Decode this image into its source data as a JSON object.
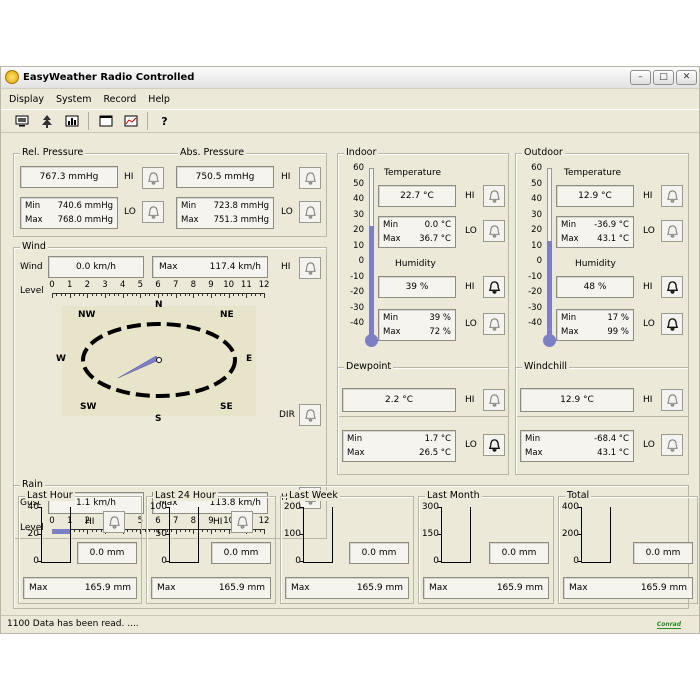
{
  "window": {
    "title": "EasyWeather Radio Controlled",
    "controls": [
      "–",
      "□",
      "✕"
    ]
  },
  "menu": [
    "Display",
    "System",
    "Record",
    "Help"
  ],
  "toolbar": [
    "monitor-icon",
    "tree-icon",
    "chart-bars-icon",
    "window-icon",
    "line-chart-icon",
    "help-icon"
  ],
  "pressure": {
    "rel": {
      "label": "Rel. Pressure",
      "value": "767.3 mmHg",
      "min": "740.6 mmHg",
      "max": "768.0 mmHg"
    },
    "abs": {
      "label": "Abs. Pressure",
      "value": "750.5 mmHg",
      "min": "723.8 mmHg",
      "max": "751.3 mmHg"
    }
  },
  "labels": {
    "hi": "HI",
    "lo": "LO",
    "min": "Min",
    "max": "Max",
    "dir": "DIR",
    "level": "Level"
  },
  "wind": {
    "label": "Wind",
    "wind_label": "Wind",
    "wind_value": "0.0 km/h",
    "wind_max": "117.4 km/h",
    "gust_label": "Gust",
    "gust_value": "1.1 km/h",
    "gust_max": "113.8 km/h",
    "level_ticks": [
      "0",
      "1",
      "2",
      "3",
      "4",
      "5",
      "6",
      "7",
      "8",
      "9",
      "10",
      "11",
      "12"
    ],
    "wind_level": 0,
    "gust_level": 1,
    "compass": {
      "N": "N",
      "NE": "NE",
      "E": "E",
      "SE": "SE",
      "S": "S",
      "SW": "SW",
      "W": "W",
      "NW": "NW"
    },
    "needle_direction": "southwest"
  },
  "indoor": {
    "label": "Indoor",
    "temp_label": "Temperature",
    "temp": "22.7 °C",
    "temp_min": "0.0 °C",
    "temp_max": "36.7 °C",
    "hum_label": "Humidity",
    "hum": "39 %",
    "hum_min": "39 %",
    "hum_max": "72 %",
    "thermo_value": 22.7
  },
  "outdoor": {
    "label": "Outdoor",
    "temp_label": "Temperature",
    "temp": "12.9 °C",
    "temp_min": "-36.9 °C",
    "temp_max": "43.1 °C",
    "hum_label": "Humidity",
    "hum": "48 %",
    "hum_min": "17 %",
    "hum_max": "99 %",
    "thermo_value": 12.9
  },
  "thermo_scale": [
    "60",
    "50",
    "40",
    "30",
    "20",
    "10",
    "0",
    "-10",
    "-20",
    "-30",
    "-40"
  ],
  "dewpoint": {
    "label": "Dewpoint",
    "value": "2.2 °C",
    "min": "1.7 °C",
    "max": "26.5 °C"
  },
  "windchill": {
    "label": "Windchill",
    "value": "12.9 °C",
    "min": "-68.4 °C",
    "max": "43.1 °C"
  },
  "rain": {
    "label": "Rain",
    "panels": [
      {
        "label": "Last Hour",
        "ticks": [
          "40",
          "20",
          "0"
        ],
        "value": "0.0 mm",
        "max": "165.9 mm",
        "has_hi": true
      },
      {
        "label": "Last 24 Hour",
        "ticks": [
          "100",
          "50",
          "0"
        ],
        "value": "0.0 mm",
        "max": "165.9 mm",
        "has_hi": true
      },
      {
        "label": "Last Week",
        "ticks": [
          "200",
          "100",
          "0"
        ],
        "value": "0.0 mm",
        "max": "165.9 mm",
        "has_hi": false
      },
      {
        "label": "Last Month",
        "ticks": [
          "300",
          "150",
          "0"
        ],
        "value": "0.0 mm",
        "max": "165.9 mm",
        "has_hi": false
      },
      {
        "label": "Total",
        "ticks": [
          "400",
          "200",
          "0"
        ],
        "value": "0.0 mm",
        "max": "165.9 mm",
        "has_hi": false
      }
    ]
  },
  "status": {
    "text": "1100 Data has been read. ....",
    "logo": "Conrad"
  },
  "colors": {
    "accent": "#7c7fc4",
    "panel": "#ece9d8",
    "compass_bg": "#e8e4c9"
  }
}
